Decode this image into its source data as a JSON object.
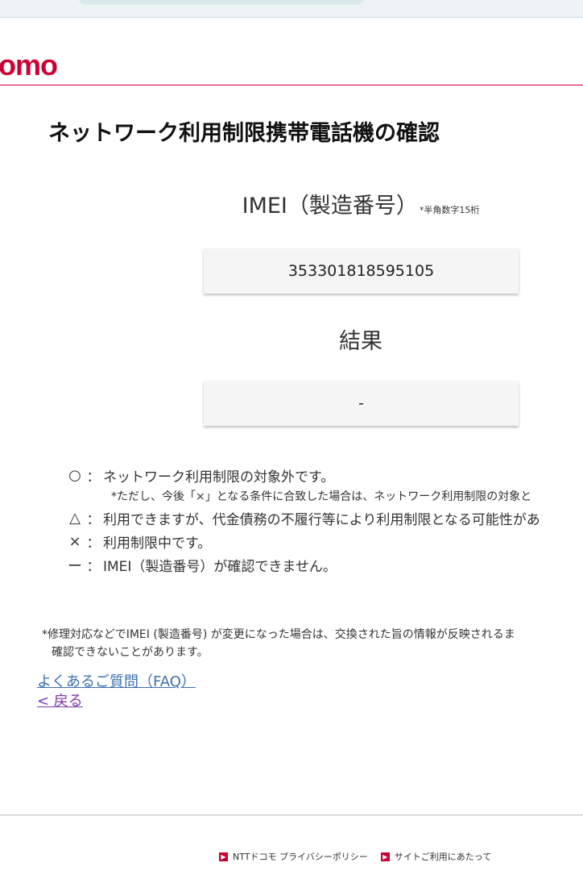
{
  "brand": {
    "logo_text": "omo",
    "color": "#cc0033"
  },
  "page": {
    "title": "ネットワーク利用制限携帯電話機の確認"
  },
  "imei": {
    "label": "IMEI（製造番号）",
    "note": "*半角数字15桁",
    "value": "353301818595105"
  },
  "result": {
    "label": "結果",
    "value": "-"
  },
  "legend": {
    "items": [
      {
        "symbol": "○",
        "colon": "：",
        "text": "ネットワーク利用制限の対象外です。"
      },
      {
        "symbol": "△",
        "colon": "：",
        "text": "利用できますが、代金債務の不履行等により利用制限となる可能性があ"
      },
      {
        "symbol": "×",
        "colon": "：",
        "text": "利用制限中です。"
      },
      {
        "symbol": "ー",
        "colon": "：",
        "text": "IMEI（製造番号）が確認できません。"
      }
    ],
    "sub_note": "*ただし、今後「×」となる条件に合致した場合は、ネットワーク利用制限の対象と"
  },
  "footnote": {
    "line1": "*修理対応などでIMEI (製造番号) が変更になった場合は、交換された旨の情報が反映されるま",
    "line2": "確認できないことがあります。"
  },
  "links": {
    "faq": "よくあるご質問（FAQ）",
    "back": "< 戻る"
  },
  "footer": {
    "links": [
      {
        "label": "NTTドコモ プライバシーポリシー"
      },
      {
        "label": "サイトご利用にあたって"
      }
    ]
  }
}
